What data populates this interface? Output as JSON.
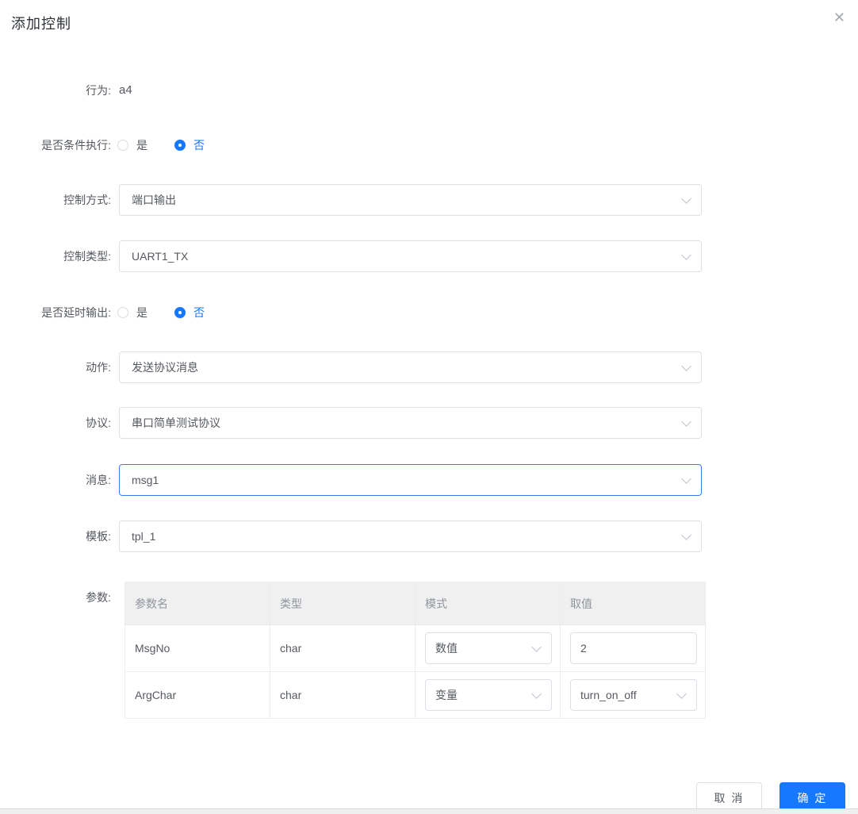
{
  "dialog": {
    "title": "添加控制"
  },
  "icons": {
    "close": "✕"
  },
  "colors": {
    "primary": "#1677ff",
    "border": "#dcdfe6",
    "table_header_bg": "#f0f0f0",
    "text": "#54585e"
  },
  "form": {
    "behavior": {
      "label": "行为:",
      "value": "a4"
    },
    "conditional": {
      "label": "是否条件执行:",
      "options": [
        {
          "label": "是",
          "selected": false
        },
        {
          "label": "否",
          "selected": true
        }
      ]
    },
    "control_method": {
      "label": "控制方式:",
      "value": "端口输出"
    },
    "control_type": {
      "label": "控制类型:",
      "value": "UART1_TX"
    },
    "delayed_output": {
      "label": "是否延时输出:",
      "options": [
        {
          "label": "是",
          "selected": false
        },
        {
          "label": "否",
          "selected": true
        }
      ]
    },
    "action": {
      "label": "动作:",
      "value": "发送协议消息"
    },
    "protocol": {
      "label": "协议:",
      "value": "串口简单测试协议"
    },
    "message": {
      "label": "消息:",
      "value": "msg1"
    },
    "template": {
      "label": "模板:",
      "value": "tpl_1"
    },
    "params": {
      "label": "参数:",
      "columns": [
        "参数名",
        "类型",
        "模式",
        "取值"
      ],
      "rows": [
        {
          "name": "MsgNo",
          "type": "char",
          "mode": "数值",
          "value": "2"
        },
        {
          "name": "ArgChar",
          "type": "char",
          "mode": "变量",
          "value": "turn_on_off"
        }
      ]
    }
  },
  "footer": {
    "cancel_label": "取 消",
    "ok_label": "确 定"
  }
}
